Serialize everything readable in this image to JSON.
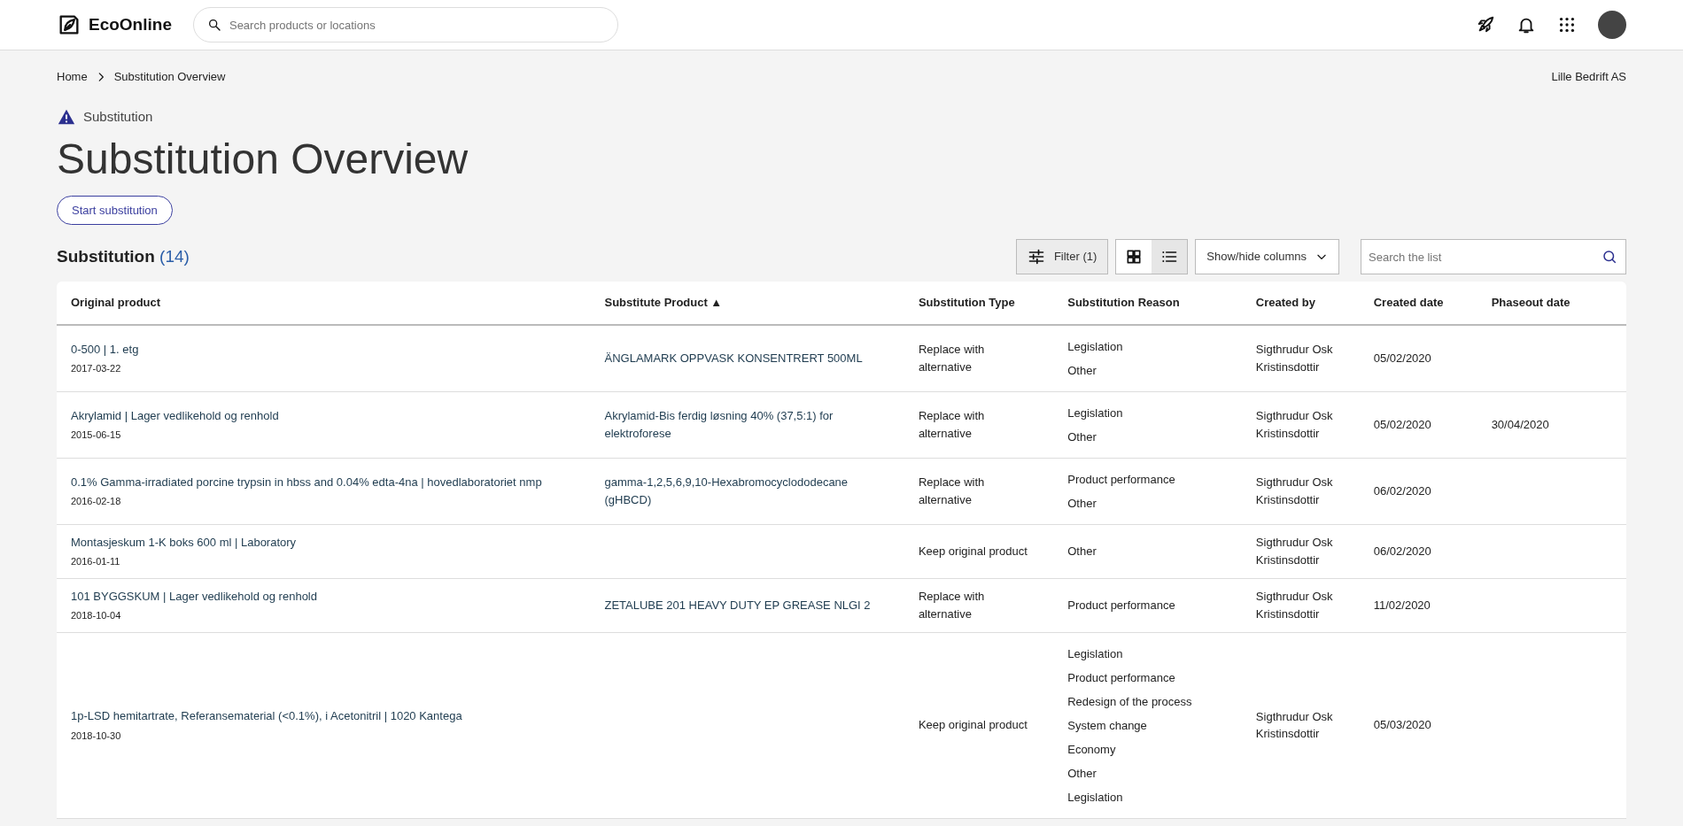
{
  "header": {
    "brand": "EcoOnline",
    "search": {
      "placeholder": "Search products or locations"
    }
  },
  "breadcrumb": [
    "Home",
    "Substitution Overview"
  ],
  "company": "Lille Bedrift AS",
  "module": "Substitution",
  "title": "Substitution Overview",
  "start_button": "Start substitution",
  "list": {
    "heading": "Substitution",
    "count": "(14)",
    "filter_button": "Filter (1)",
    "views": [
      {
        "kind": "grid",
        "selected": false
      },
      {
        "kind": "list",
        "selected": true
      }
    ],
    "columns_button": "Show/hide columns",
    "search": {
      "placeholder": "Search the list"
    }
  },
  "table": {
    "columns": [
      "Original product",
      "Substitute Product ▲",
      "Substitution Type",
      "Substitution Reason",
      "Created by",
      "Created date",
      "Phaseout date"
    ],
    "rows": [
      {
        "original": "0-500 | 1. etg",
        "original_date": "2017-03-22",
        "substitute": "ÄNGLAMARK OPPVASK KONSENTRERT 500ML",
        "type": "Replace with alternative",
        "reasons": [
          "Legislation",
          "Other"
        ],
        "created_by": "Sigthrudur Osk Kristinsdottir",
        "created_date": "05/02/2020",
        "phaseout_date": ""
      },
      {
        "original": "Akrylamid | Lager vedlikehold og renhold",
        "original_date": "2015-06-15",
        "substitute": "Akrylamid-Bis ferdig løsning 40% (37,5:1) for elektroforese",
        "type": "Replace with alternative",
        "reasons": [
          "Legislation",
          "Other"
        ],
        "created_by": "Sigthrudur Osk Kristinsdottir",
        "created_date": "05/02/2020",
        "phaseout_date": "30/04/2020"
      },
      {
        "original": "0.1% Gamma-irradiated porcine trypsin in hbss and 0.04% edta-4na | hovedlaboratoriet nmp",
        "original_date": "2016-02-18",
        "substitute": "gamma-1,2,5,6,9,10-Hexabromocyclododecane (gHBCD)",
        "type": "Replace with alternative",
        "reasons": [
          "Product performance",
          "Other"
        ],
        "created_by": "Sigthrudur Osk Kristinsdottir",
        "created_date": "06/02/2020",
        "phaseout_date": ""
      },
      {
        "original": "Montasjeskum 1-K boks 600 ml | Laboratory",
        "original_date": "2016-01-11",
        "substitute": "",
        "type": "Keep original product",
        "reasons": [
          "Other"
        ],
        "created_by": "Sigthrudur Osk Kristinsdottir",
        "created_date": "06/02/2020",
        "phaseout_date": ""
      },
      {
        "original": "101 BYGGSKUM | Lager vedlikehold og renhold",
        "original_date": "2018-10-04",
        "substitute": "ZETALUBE 201 HEAVY DUTY EP GREASE NLGI 2",
        "type": "Replace with alternative",
        "reasons": [
          "Product performance"
        ],
        "created_by": "Sigthrudur Osk Kristinsdottir",
        "created_date": "11/02/2020",
        "phaseout_date": ""
      },
      {
        "original": "1p-LSD hemitartrate, Referansematerial (<0.1%), i Acetonitril | 1020 Kantega",
        "original_date": "2018-10-30",
        "substitute": "",
        "type": "Keep original product",
        "reasons": [
          "Legislation",
          "Product performance",
          "Redesign of the process",
          "System change",
          "Economy",
          "Other",
          "Legislation"
        ],
        "created_by": "Sigthrudur Osk Kristinsdottir",
        "created_date": "05/03/2020",
        "phaseout_date": ""
      }
    ]
  }
}
